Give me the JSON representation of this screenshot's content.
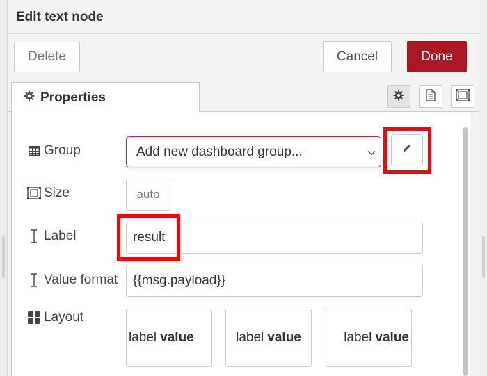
{
  "dialog": {
    "title": "Edit text node"
  },
  "toolbar": {
    "delete_label": "Delete",
    "cancel_label": "Cancel",
    "done_label": "Done"
  },
  "tabs": {
    "properties_label": "Properties"
  },
  "fields": {
    "group": {
      "label": "Group",
      "selected_value": "Add new dashboard group..."
    },
    "size": {
      "label": "Size",
      "value": "auto"
    },
    "label": {
      "label": "Label",
      "value": "result"
    },
    "value_format": {
      "label": "Value format",
      "value": "{{msg.payload}}"
    },
    "layout": {
      "label": "Layout",
      "options": [
        {
          "label_text": "label",
          "value_text": "value"
        },
        {
          "label_text": "label",
          "value_text": "value"
        },
        {
          "label_text": "label",
          "value_text": "value"
        }
      ]
    }
  },
  "colors": {
    "accent": "#ad1625",
    "highlight": "#ff0000",
    "field_error_border": "#c62828"
  },
  "icons": {
    "tab": "gear-icon",
    "tab_buttons": [
      "gear-icon",
      "document-icon",
      "node-frame-icon"
    ],
    "group": "table-icon",
    "size": "resize-icon",
    "label": "text-cursor-icon",
    "value_format": "text-cursor-icon",
    "layout": "grid-icon",
    "edit": "pencil-icon",
    "select": "chevron-down-icon"
  }
}
